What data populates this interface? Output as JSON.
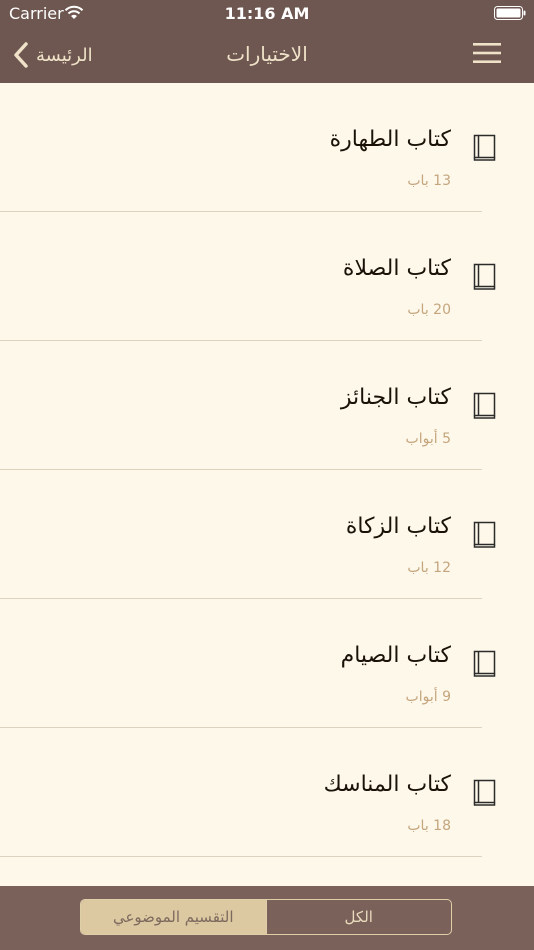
{
  "status_bar": {
    "carrier": "Carrier",
    "time": "11:16 AM"
  },
  "nav": {
    "back_label": "الرئيسة",
    "title": "الاختيارات"
  },
  "items": [
    {
      "title": "كتاب الطهارة",
      "subtitle": "13 باب"
    },
    {
      "title": "كتاب الصلاة",
      "subtitle": "20 باب"
    },
    {
      "title": "كتاب الجنائز",
      "subtitle": "5 أبواب"
    },
    {
      "title": "كتاب الزكاة",
      "subtitle": "12 باب"
    },
    {
      "title": "كتاب الصيام",
      "subtitle": "9 أبواب"
    },
    {
      "title": "كتاب المناسك",
      "subtitle": "18 باب"
    }
  ],
  "segments": {
    "topical": "التقسيم الموضوعي",
    "all": "الكل",
    "selected": "topical"
  },
  "colors": {
    "bar": "#6d5750",
    "background": "#fdf8ea",
    "accent": "#c4a57e"
  },
  "icons": {
    "menu": "menu-icon",
    "back": "chevron-left-icon",
    "book": "book-icon"
  }
}
